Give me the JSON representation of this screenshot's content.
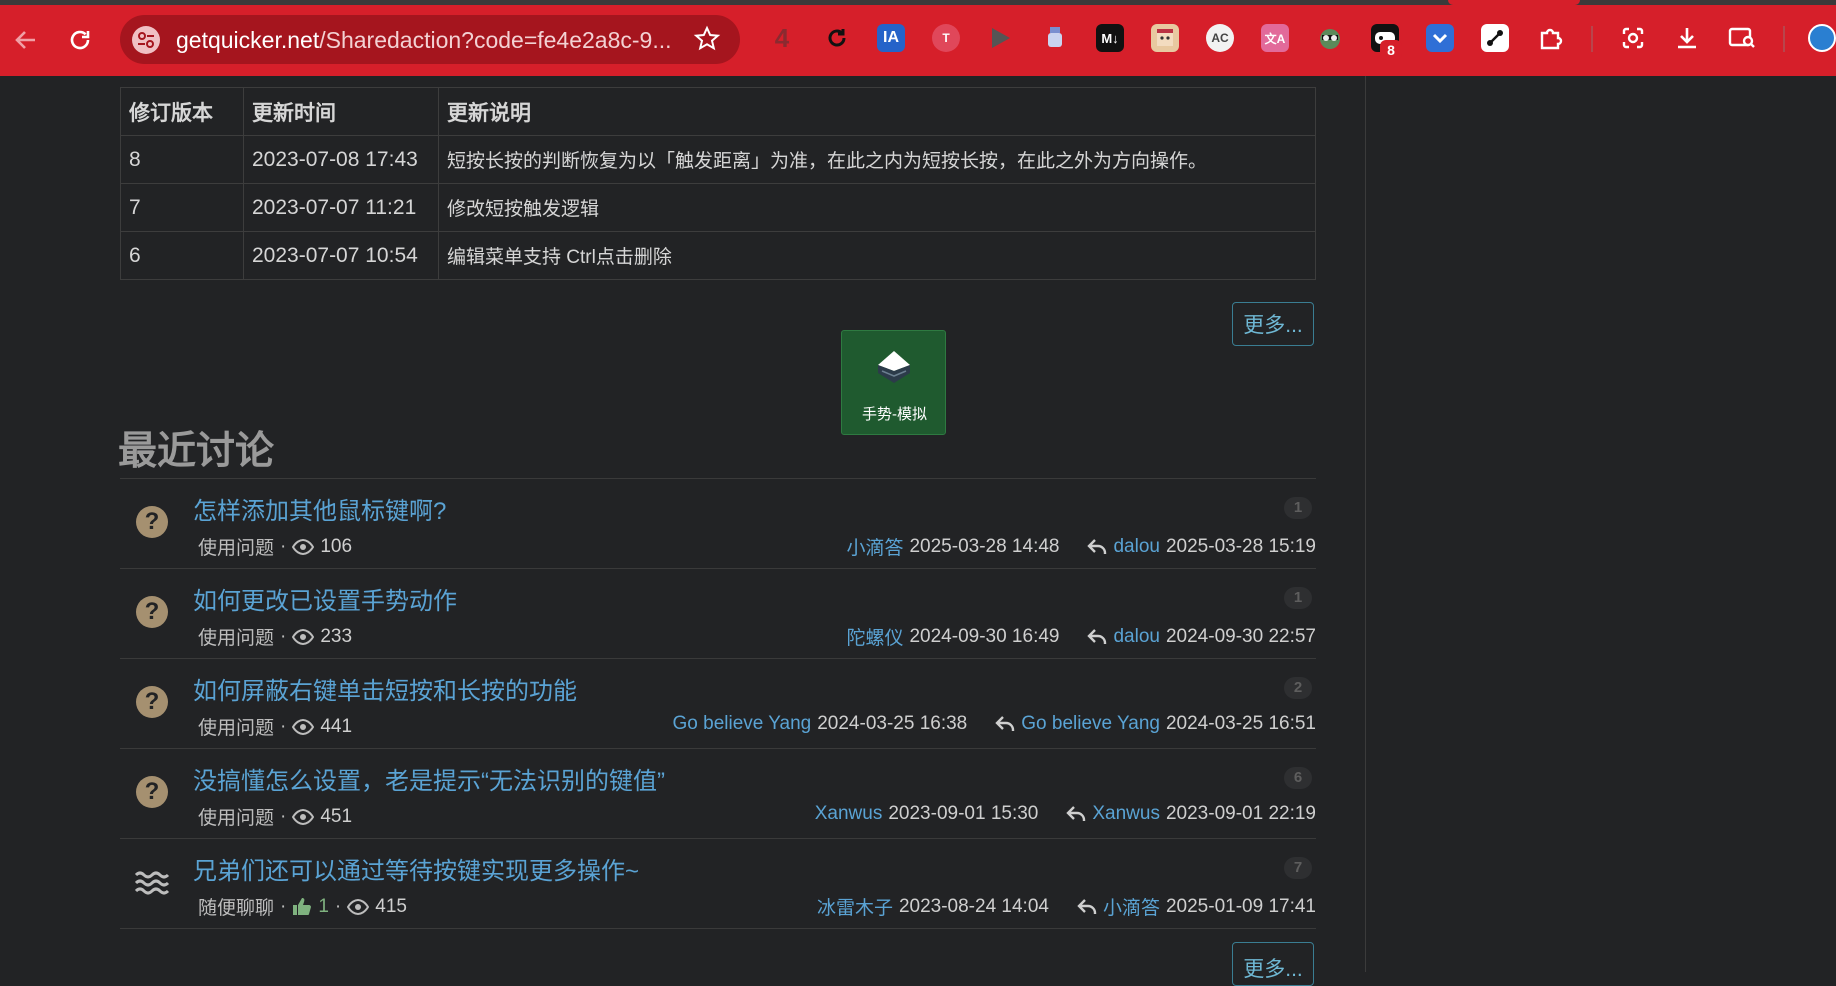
{
  "browser": {
    "url_host": "getquicker.net",
    "url_rest": "/Sharedaction?code=fe4e2a8c-9...",
    "ext_badge_count": "8"
  },
  "revisions": {
    "headers": [
      "修订版本",
      "更新时间",
      "更新说明"
    ],
    "rows": [
      {
        "version": "8",
        "time": "2023-07-08 17:43",
        "desc": "短按长按的判断恢复为以「触发距离」为准，在此之内为短按长按，在此之外为方向操作。"
      },
      {
        "version": "7",
        "time": "2023-07-07 11:21",
        "desc": "修改短按触发逻辑"
      },
      {
        "version": "6",
        "time": "2023-07-07 10:54",
        "desc": "编辑菜单支持 Ctrl点击删除"
      }
    ],
    "more_label": "更多..."
  },
  "action_card": {
    "label": "手势-模拟"
  },
  "discussions": {
    "title": "最近讨论",
    "more_label": "更多...",
    "items": [
      {
        "kind": "question",
        "title": "怎样添加其他鼠标键啊?",
        "category": "使用问题",
        "likes": "",
        "views": "106",
        "author": "小滴答",
        "posted": "2025-03-28 14:48",
        "last_replier": "dalou",
        "last_time": "2025-03-28 15:19",
        "count": "1"
      },
      {
        "kind": "question",
        "title": "如何更改已设置手势动作",
        "category": "使用问题",
        "likes": "",
        "views": "233",
        "author": "陀螺仪",
        "posted": "2024-09-30 16:49",
        "last_replier": "dalou",
        "last_time": "2024-09-30 22:57",
        "count": "1"
      },
      {
        "kind": "question",
        "title": "如何屏蔽右键单击短按和长按的功能",
        "category": "使用问题",
        "likes": "",
        "views": "441",
        "author": "Go believe Yang",
        "posted": "2024-03-25 16:38",
        "last_replier": "Go believe Yang",
        "last_time": "2024-03-25 16:51",
        "count": "2"
      },
      {
        "kind": "question",
        "title": "没搞懂怎么设置，老是提示“无法识别的键值”",
        "category": "使用问题",
        "likes": "",
        "views": "451",
        "author": "Xanwus",
        "posted": "2023-09-01 15:30",
        "last_replier": "Xanwus",
        "last_time": "2023-09-01 22:19",
        "count": "6"
      },
      {
        "kind": "chat",
        "title": "兄弟们还可以通过等待按键实现更多操作~",
        "category": "随便聊聊",
        "likes": "1",
        "views": "415",
        "author": "冰雷木子",
        "posted": "2023-08-24 14:04",
        "last_replier": "小滴答",
        "last_time": "2025-01-09 17:41",
        "count": "7"
      }
    ]
  },
  "colors": {
    "toolbar": "#d61f2a",
    "page_bg": "#222325",
    "link": "#5aa3d4",
    "action_card_bg": "#1f5a2f",
    "question_icon": "#a59070"
  }
}
